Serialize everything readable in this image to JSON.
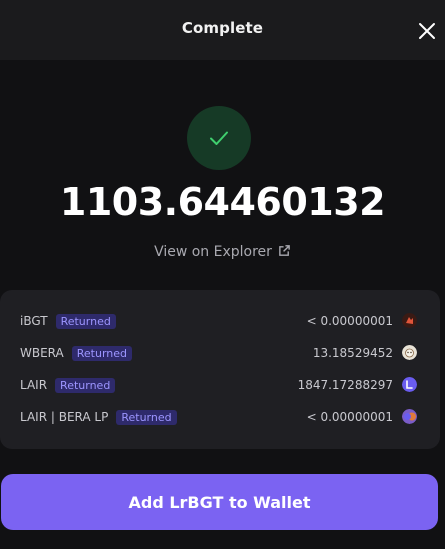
{
  "header": {
    "title": "Complete"
  },
  "result": {
    "amount": "1103.64460132",
    "explorer_label": "View on Explorer"
  },
  "tokens": [
    {
      "name": "iBGT",
      "badge": "Returned",
      "value": "< 0.00000001",
      "icon": "ibgt-token-icon",
      "icon_color": "#3a1a14"
    },
    {
      "name": "WBERA",
      "badge": "Returned",
      "value": "13.18529452",
      "icon": "wbera-token-icon",
      "icon_color": "#e8e2d6"
    },
    {
      "name": "LAIR",
      "badge": "Returned",
      "value": "1847.17288297",
      "icon": "lair-token-icon",
      "icon_color": "#6a5cf0"
    },
    {
      "name": "LAIR | BERA LP",
      "badge": "Returned",
      "value": "< 0.00000001",
      "icon": "lair-bera-lp-token-icon",
      "icon_color": "#7a5cc8"
    }
  ],
  "footer": {
    "button_label": "Add LrBGT to Wallet"
  },
  "colors": {
    "accent": "#7b63f2",
    "success": "#3fcf6e",
    "badge_bg": "#2e2a6b",
    "badge_text": "#9c95ff"
  }
}
